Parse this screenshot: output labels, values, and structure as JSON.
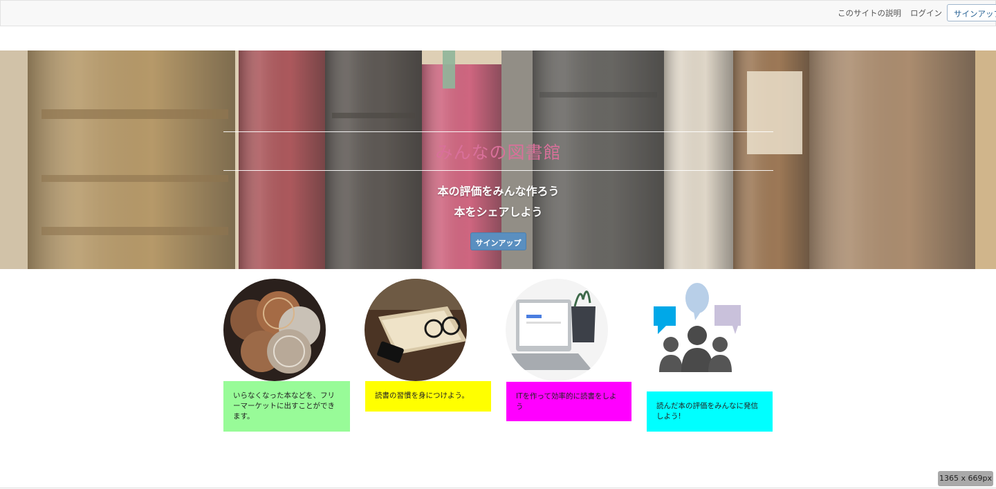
{
  "navbar": {
    "about_label": "このサイトの説明",
    "login_label": "ログイン",
    "signup_label": "サインアップ"
  },
  "hero": {
    "title": "みんなの図書館",
    "tagline_line1": "本の評価をみんな作ろう",
    "tagline_line2": "本をシェアしよう",
    "signup_button": "サインアップ",
    "background_image": "old-book-spines-photo"
  },
  "features": [
    {
      "image": "coins-photo",
      "text": "いらなくなった本などを、フリーマーケットに出すことができます。",
      "color": "#98fb98"
    },
    {
      "image": "book-and-glasses-photo",
      "text": "読書の習慣を身につけよう。",
      "color": "#ffff00"
    },
    {
      "image": "laptop-google-photo",
      "text": "ITを作って効率的に読書をしよう",
      "color": "#ff00ff"
    },
    {
      "image": "people-speech-bubbles-icon",
      "text": "読んだ本の評価をみんなに発信しよう!",
      "color": "#00ffff"
    }
  ],
  "viewport_badge": "1365 x 669px",
  "colors": {
    "title_pink": "#d9709a",
    "button_blue": "#5a8fc0",
    "link_blue": "#2a6496"
  }
}
